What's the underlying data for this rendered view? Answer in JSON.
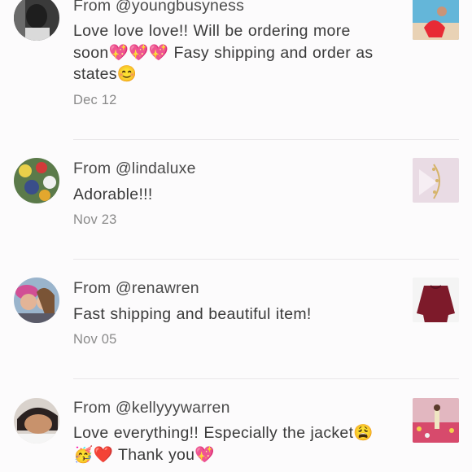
{
  "reviews": [
    {
      "from": "From @youngbusyness",
      "text": "Love love love!! Will be ordering more soon💖💖💖 Fasy shipping and order as states😊",
      "date": "Dec 12"
    },
    {
      "from": "From @lindaluxe",
      "text": "Adorable!!!",
      "date": "Nov 23"
    },
    {
      "from": "From @renawren",
      "text": "Fast shipping and beautiful item!",
      "date": "Nov 05"
    },
    {
      "from": "From @kellyyywarren",
      "text": "Love everything!! Especially the jacket😩🥳❤️ Thank you💖",
      "date": ""
    }
  ],
  "colors": {
    "background": "#fcfbfc",
    "username_text": "#4a4a4a",
    "date_text": "#8a8a8a",
    "divider": "#e8e6e8"
  }
}
